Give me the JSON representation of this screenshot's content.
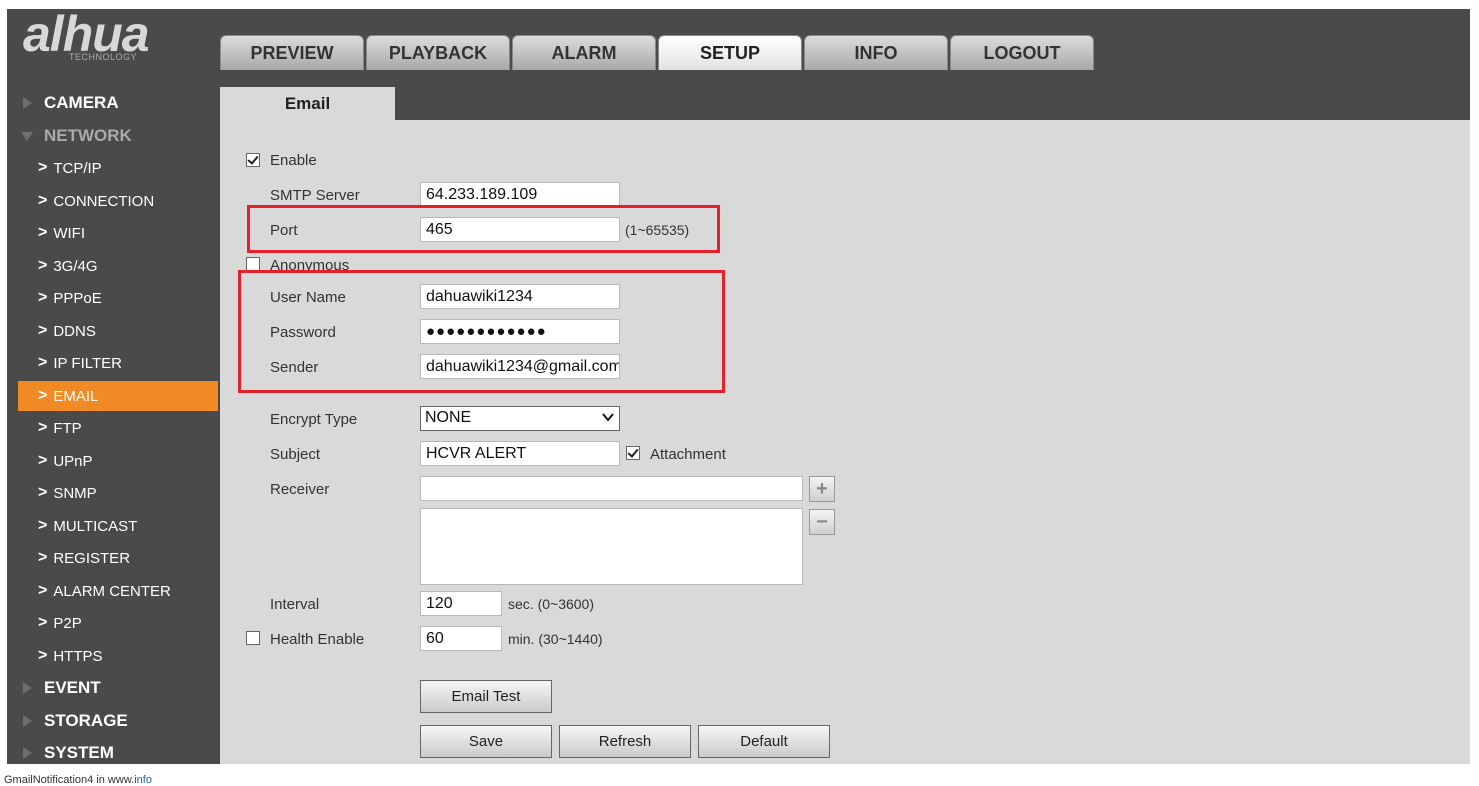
{
  "logo": {
    "word": "alhua",
    "sub": "TECHNOLOGY"
  },
  "tabs": [
    {
      "label": "PREVIEW"
    },
    {
      "label": "PLAYBACK"
    },
    {
      "label": "ALARM"
    },
    {
      "label": "SETUP"
    },
    {
      "label": "INFO"
    },
    {
      "label": "LOGOUT"
    }
  ],
  "active_tab": "SETUP",
  "sidebar": {
    "camera": "CAMERA",
    "network": "NETWORK",
    "items": [
      "TCP/IP",
      "CONNECTION",
      "WIFI",
      "3G/4G",
      "PPPoE",
      "DDNS",
      "IP FILTER",
      "EMAIL",
      "FTP",
      "UPnP",
      "SNMP",
      "MULTICAST",
      "REGISTER",
      "ALARM CENTER",
      "P2P",
      "HTTPS"
    ],
    "active_item": "EMAIL",
    "event": "EVENT",
    "storage": "STORAGE",
    "system": "SYSTEM"
  },
  "content": {
    "tab_label": "Email",
    "enable": {
      "label": "Enable",
      "checked": true
    },
    "smtp_server": {
      "label": "SMTP Server",
      "value": "64.233.189.109"
    },
    "port": {
      "label": "Port",
      "value": "465",
      "hint": "(1~65535)"
    },
    "anonymous": {
      "label": "Anonymous",
      "checked": false
    },
    "user_name": {
      "label": "User Name",
      "value": "dahuawiki1234"
    },
    "password": {
      "label": "Password",
      "value": "●●●●●●●●●●●●"
    },
    "sender": {
      "label": "Sender",
      "value": "dahuawiki1234@gmail.com"
    },
    "encrypt_type": {
      "label": "Encrypt Type",
      "value": "NONE"
    },
    "subject": {
      "label": "Subject",
      "value": "HCVR ALERT"
    },
    "attachment": {
      "label": "Attachment",
      "checked": true
    },
    "receiver": {
      "label": "Receiver",
      "value": ""
    },
    "add_symbol": "+",
    "remove_symbol": "−",
    "interval": {
      "label": "Interval",
      "value": "120",
      "hint": "sec. (0~3600)"
    },
    "health_enable": {
      "label": "Health Enable",
      "checked": false,
      "value": "60",
      "hint": "min. (30~1440)"
    },
    "buttons": {
      "email_test": "Email Test",
      "save": "Save",
      "refresh": "Refresh",
      "default": "Default"
    }
  },
  "caption": {
    "text": "GmailNotification4 in www.",
    "link": "info"
  },
  "colors": {
    "accent": "#f08a24",
    "highlight": "#e4202a",
    "frame": "#4a4a4a",
    "panel": "#d9d9d9"
  }
}
